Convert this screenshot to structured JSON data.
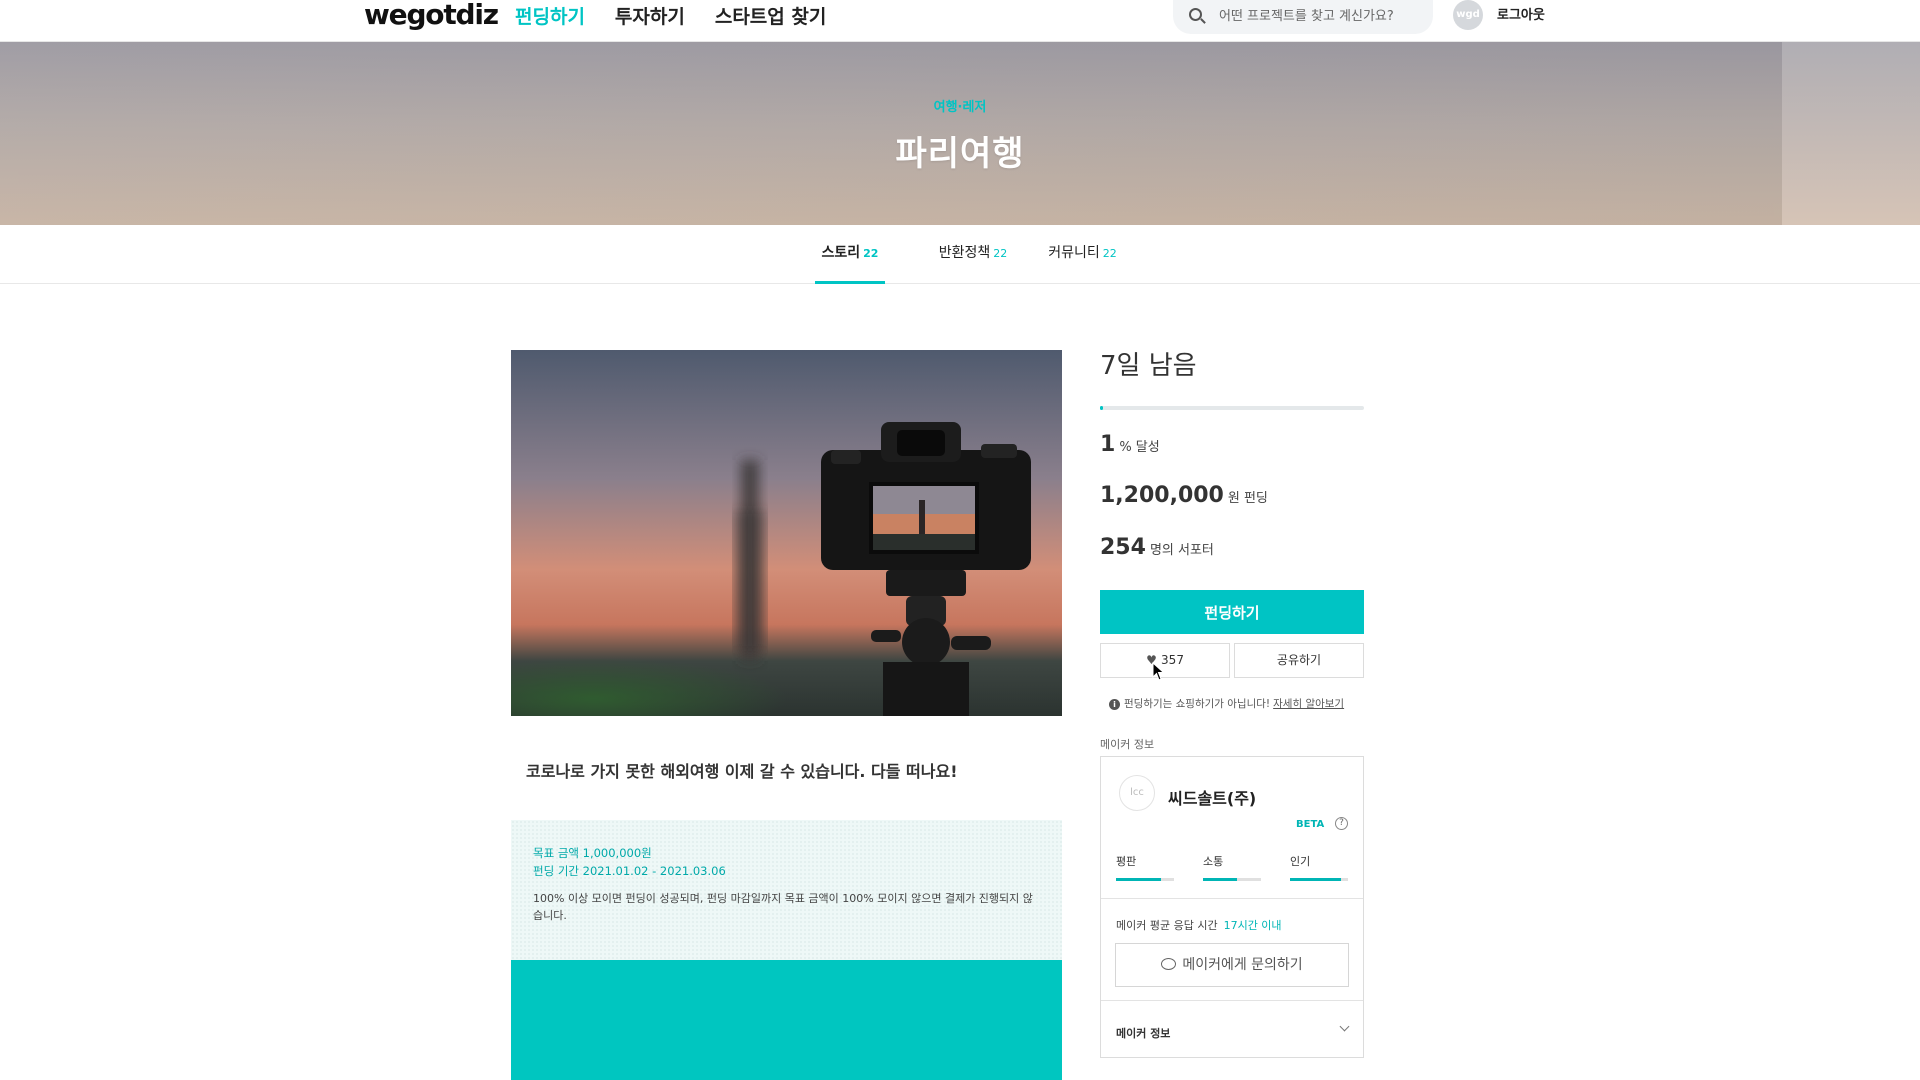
{
  "header": {
    "logo": "wegotdiz",
    "nav": [
      {
        "label": "펀딩하기",
        "active": true
      },
      {
        "label": "투자하기",
        "active": false
      },
      {
        "label": "스타트업 찾기",
        "active": false
      }
    ],
    "search_placeholder": "어떤 프로젝트를 찾고 계신가요?",
    "avatar_text": "wgd",
    "logout_label": "로그아웃"
  },
  "hero": {
    "category": "여행·레저",
    "title": "파리여행"
  },
  "tabs": [
    {
      "label": "스토리",
      "count": "22",
      "active": true
    },
    {
      "label": "반환정책",
      "count": "22",
      "active": false
    },
    {
      "label": "커뮤니티",
      "count": "22",
      "active": false
    }
  ],
  "story": {
    "tagline": "코로나로 가지 못한 해외여행 이제 갈 수 있습니다. 다들 떠나요!",
    "goal_amount": "목표 금액 1,000,000원",
    "period": "펀딩 기간 2021.01.02 - 2021.03.06",
    "description": "100% 이상 모이면 펀딩이 성공되며, 펀딩 마감일까지 목표 금액이 100% 모이지 않으면 결제가 진행되지 않습니다."
  },
  "funding": {
    "days_left": "7일 남음",
    "progress_percent": 1,
    "achieved_value": "1",
    "achieved_unit": "% 달성",
    "amount_value": "1,200,000",
    "amount_unit": "원 펀딩",
    "supporters_value": "254",
    "supporters_unit": "명의 서포터",
    "fund_button": "펀딩하기",
    "like_count": "357",
    "share_button": "공유하기",
    "notice": "펀딩하기는 쇼핑하기가 아닙니다!",
    "notice_link": "자세히 알아보기"
  },
  "maker": {
    "section_label": "메이커 정보",
    "logo_text": "lcc",
    "name": "씨드솔트(주)",
    "beta": "BETA",
    "stats": [
      {
        "label": "평판",
        "level": 0.78
      },
      {
        "label": "소통",
        "level": 0.58
      },
      {
        "label": "인기",
        "level": 0.88
      }
    ],
    "response_label": "메이커 평균 응답 시간",
    "response_value": "17시간 이내",
    "ask_button": "메이커에게 문의하기",
    "info_toggle": "메이커 정보"
  },
  "colors": {
    "accent": "#00c4c4"
  }
}
